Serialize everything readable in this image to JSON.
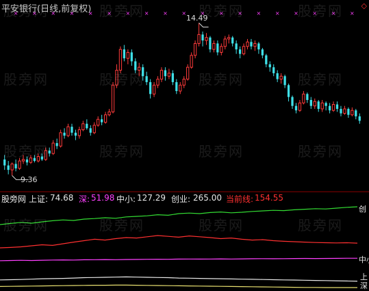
{
  "title": "平安银行(日线,前复权)",
  "watermark": "股旁网",
  "annotations": {
    "high_label": "14.49",
    "low_label": "9.36"
  },
  "indicator_bar": {
    "name": "股旁网",
    "items": [
      {
        "label": "上证:",
        "value": "74.68",
        "color": "#e8e8e8",
        "label_color": "#e8e8e8"
      },
      {
        "label": "深:",
        "value": "51.98",
        "color": "#ff40ff",
        "label_color": "#ff40ff"
      },
      {
        "label": "中小:",
        "value": "127.29",
        "color": "#e8e8e8",
        "label_color": "#e8e8e8"
      },
      {
        "label": "创业:",
        "value": "265.00",
        "color": "#e8e8e8",
        "label_color": "#e8e8e8"
      },
      {
        "label": "当前线:",
        "value": "154.55",
        "color": "#ff3030",
        "label_color": "#ff3030"
      }
    ]
  },
  "end_labels": {
    "chuangye": "创",
    "zhongxiao": "中小",
    "shangzheng": "上",
    "shen": "深"
  },
  "colors": {
    "up": "#ff3b3b",
    "down": "#3fe0e8",
    "marker": "#ff40ff",
    "chuangye": "#33dd33",
    "dangqian": "#ff3030",
    "zhongxiao": "#ff40ff",
    "shangzheng": "#e8e8e8",
    "shen": "#e8e070"
  },
  "chart_data": [
    {
      "type": "candlestick",
      "high_annotation": 14.49,
      "low_annotation": 9.36,
      "ylim": [
        9.0,
        14.8
      ],
      "candles": [
        [
          9.9,
          9.7,
          10.05,
          9.55
        ],
        [
          9.7,
          9.55,
          9.85,
          9.4
        ],
        [
          9.55,
          9.75,
          9.8,
          9.36
        ],
        [
          9.75,
          9.6,
          9.9,
          9.5
        ],
        [
          9.6,
          9.85,
          9.95,
          9.55
        ],
        [
          9.85,
          9.9,
          10.05,
          9.75
        ],
        [
          9.9,
          9.8,
          10.0,
          9.7
        ],
        [
          9.8,
          9.95,
          10.05,
          9.75
        ],
        [
          9.95,
          9.85,
          10.05,
          9.8
        ],
        [
          9.85,
          10.0,
          10.1,
          9.8
        ],
        [
          10.0,
          9.9,
          10.1,
          9.85
        ],
        [
          9.9,
          10.2,
          10.3,
          9.85
        ],
        [
          10.2,
          10.1,
          10.3,
          10.0
        ],
        [
          10.1,
          10.45,
          10.55,
          10.05
        ],
        [
          10.45,
          10.35,
          10.6,
          10.25
        ],
        [
          10.35,
          10.8,
          10.9,
          10.3
        ],
        [
          10.8,
          10.7,
          10.95,
          10.6
        ],
        [
          10.7,
          11.0,
          11.1,
          10.65
        ],
        [
          11.0,
          10.8,
          11.1,
          10.7
        ],
        [
          10.8,
          10.7,
          10.9,
          10.55
        ],
        [
          10.7,
          10.9,
          11.0,
          10.6
        ],
        [
          10.9,
          11.1,
          11.2,
          10.85
        ],
        [
          11.1,
          10.95,
          11.25,
          10.9
        ],
        [
          10.95,
          10.8,
          11.05,
          10.7
        ],
        [
          10.8,
          11.05,
          11.15,
          10.75
        ],
        [
          11.05,
          11.25,
          11.35,
          11.0
        ],
        [
          11.25,
          11.15,
          11.4,
          11.05
        ],
        [
          11.15,
          11.4,
          11.5,
          11.1
        ],
        [
          11.4,
          11.5,
          11.6,
          11.35
        ],
        [
          11.5,
          12.4,
          12.5,
          11.45
        ],
        [
          12.4,
          12.9,
          13.1,
          12.3
        ],
        [
          12.9,
          13.6,
          13.7,
          12.8
        ],
        [
          13.6,
          13.3,
          13.75,
          13.2
        ],
        [
          13.3,
          13.5,
          13.6,
          13.1
        ],
        [
          13.5,
          13.2,
          13.6,
          13.05
        ],
        [
          13.2,
          12.9,
          13.3,
          12.8
        ],
        [
          12.9,
          13.0,
          13.15,
          12.7
        ],
        [
          13.0,
          12.7,
          13.1,
          12.55
        ],
        [
          12.7,
          12.5,
          12.85,
          12.4
        ],
        [
          12.5,
          12.1,
          12.6,
          11.95
        ],
        [
          12.1,
          12.4,
          12.5,
          12.0
        ],
        [
          12.4,
          12.6,
          12.7,
          12.3
        ],
        [
          12.6,
          12.9,
          13.0,
          12.5
        ],
        [
          12.9,
          12.7,
          13.0,
          12.55
        ],
        [
          12.7,
          12.8,
          12.95,
          12.6
        ],
        [
          12.8,
          12.5,
          12.9,
          12.4
        ],
        [
          12.5,
          12.2,
          12.6,
          12.1
        ],
        [
          12.2,
          12.4,
          12.5,
          12.1
        ],
        [
          12.4,
          12.6,
          12.7,
          12.3
        ],
        [
          12.6,
          13.0,
          13.1,
          12.55
        ],
        [
          13.0,
          13.4,
          13.5,
          12.95
        ],
        [
          13.4,
          13.8,
          13.9,
          13.3
        ],
        [
          13.8,
          14.1,
          14.49,
          13.7
        ],
        [
          14.1,
          13.9,
          14.2,
          13.7
        ],
        [
          13.9,
          14.0,
          14.15,
          13.75
        ],
        [
          14.0,
          13.6,
          14.05,
          13.5
        ],
        [
          13.6,
          13.8,
          13.9,
          13.5
        ],
        [
          13.8,
          13.5,
          13.9,
          13.4
        ],
        [
          13.5,
          13.7,
          13.8,
          13.4
        ],
        [
          13.7,
          13.95,
          14.05,
          13.6
        ],
        [
          13.95,
          14.0,
          14.1,
          13.8
        ],
        [
          14.0,
          13.8,
          14.05,
          13.7
        ],
        [
          13.8,
          13.6,
          13.9,
          13.45
        ],
        [
          13.6,
          13.45,
          13.7,
          13.3
        ],
        [
          13.45,
          13.7,
          13.8,
          13.4
        ],
        [
          13.7,
          13.85,
          13.95,
          13.6
        ],
        [
          13.85,
          13.7,
          13.95,
          13.6
        ],
        [
          13.7,
          13.8,
          13.9,
          13.55
        ],
        [
          13.8,
          13.6,
          13.85,
          13.45
        ],
        [
          13.6,
          13.4,
          13.65,
          13.3
        ],
        [
          13.4,
          13.1,
          13.45,
          13.0
        ],
        [
          13.1,
          13.0,
          13.2,
          12.85
        ],
        [
          13.0,
          12.8,
          13.1,
          12.7
        ],
        [
          12.8,
          12.6,
          12.9,
          12.5
        ],
        [
          12.6,
          12.7,
          12.8,
          12.45
        ],
        [
          12.7,
          12.4,
          12.75,
          12.3
        ],
        [
          12.4,
          12.0,
          12.45,
          11.85
        ],
        [
          12.0,
          11.7,
          12.05,
          11.6
        ],
        [
          11.7,
          11.55,
          11.8,
          11.45
        ],
        [
          11.55,
          11.8,
          11.9,
          11.5
        ],
        [
          11.8,
          12.1,
          12.2,
          11.75
        ],
        [
          12.1,
          11.9,
          12.15,
          11.8
        ],
        [
          11.9,
          11.7,
          12.0,
          11.6
        ],
        [
          11.7,
          11.85,
          11.95,
          11.6
        ],
        [
          11.85,
          11.6,
          11.9,
          11.5
        ],
        [
          11.6,
          11.8,
          11.9,
          11.5
        ],
        [
          11.8,
          11.7,
          11.85,
          11.55
        ],
        [
          11.7,
          11.55,
          11.8,
          11.45
        ],
        [
          11.55,
          11.75,
          11.85,
          11.5
        ],
        [
          11.75,
          11.6,
          11.85,
          11.5
        ],
        [
          11.6,
          11.45,
          11.7,
          11.35
        ],
        [
          11.45,
          11.6,
          11.7,
          11.4
        ],
        [
          11.6,
          11.4,
          11.65,
          11.3
        ],
        [
          11.4,
          11.55,
          11.65,
          11.35
        ],
        [
          11.55,
          11.35,
          11.6,
          11.25
        ],
        [
          11.35,
          11.2,
          11.45,
          11.1
        ]
      ]
    },
    {
      "type": "line",
      "series": [
        {
          "name": "创业",
          "color": "#33dd33",
          "values": [
            0.3,
            0.34,
            0.38,
            0.35,
            0.4,
            0.44,
            0.47,
            0.45,
            0.5,
            0.52,
            0.55,
            0.53,
            0.58,
            0.6,
            0.62,
            0.66,
            0.64,
            0.7,
            0.72,
            0.7,
            0.74,
            0.76,
            0.73,
            0.75,
            0.78,
            0.8,
            0.82,
            0.81,
            0.84,
            0.86,
            0.88,
            0.87,
            0.9,
            0.93,
            0.95
          ]
        },
        {
          "name": "当前线",
          "color": "#ff3030",
          "values": [
            0.1,
            0.12,
            0.15,
            0.2,
            0.25,
            0.22,
            0.3,
            0.38,
            0.45,
            0.52,
            0.48,
            0.55,
            0.6,
            0.58,
            0.64,
            0.7,
            0.66,
            0.62,
            0.68,
            0.64,
            0.6,
            0.55,
            0.58,
            0.52,
            0.48,
            0.5,
            0.45,
            0.42,
            0.4,
            0.38,
            0.36,
            0.35,
            0.34,
            0.35,
            0.33
          ]
        },
        {
          "name": "中小",
          "color": "#ff40ff",
          "values": [
            0.28,
            0.3,
            0.32,
            0.3,
            0.33,
            0.35,
            0.36,
            0.35,
            0.37,
            0.38,
            0.39,
            0.38,
            0.4,
            0.41,
            0.42,
            0.43,
            0.42,
            0.44,
            0.45,
            0.44,
            0.45,
            0.46,
            0.45,
            0.46,
            0.47,
            0.48,
            0.47,
            0.48,
            0.49,
            0.5,
            0.49,
            0.5,
            0.51,
            0.52,
            0.52
          ]
        },
        {
          "name": "上证",
          "color": "#e8e8e8",
          "values": [
            0.12,
            0.13,
            0.14,
            0.16,
            0.18,
            0.19,
            0.2,
            0.22,
            0.24,
            0.25,
            0.26,
            0.27,
            0.28,
            0.27,
            0.26,
            0.25,
            0.24,
            0.22,
            0.21,
            0.2,
            0.19,
            0.18,
            0.17,
            0.16,
            0.15,
            0.14,
            0.13,
            0.12,
            0.11,
            0.1,
            0.09,
            0.08,
            0.07,
            0.06,
            0.05
          ]
        },
        {
          "name": "深",
          "color": "#e8e070",
          "values": [
            0.08,
            0.09,
            0.1,
            0.11,
            0.12,
            0.13,
            0.14,
            0.15,
            0.16,
            0.17,
            0.17,
            0.18,
            0.18,
            0.17,
            0.16,
            0.15,
            0.14,
            0.13,
            0.12,
            0.11,
            0.1,
            0.09,
            0.08,
            0.07,
            0.06,
            0.05,
            0.04,
            0.03,
            0.02,
            0.01,
            0.01,
            0.0,
            0.0,
            0.0,
            0.0
          ]
        }
      ]
    }
  ]
}
